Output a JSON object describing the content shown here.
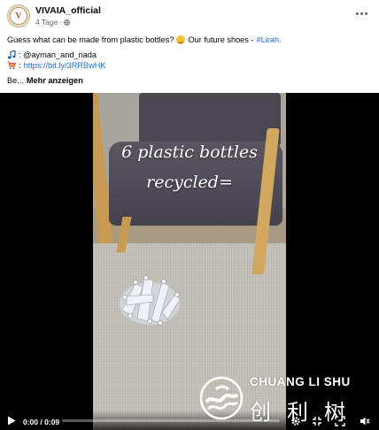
{
  "post": {
    "page_name": "VIVAIA_official",
    "timestamp": "4 Tage",
    "separator": "·",
    "avatar_text": "V",
    "privacy_icon": "globe-icon",
    "more_icon": "more-horizontal-icon",
    "text_main": "Guess what can be made from plastic bottles?",
    "text_after_emoji": "Our future shoes -",
    "hashtag": "#Leah.",
    "emoji_1": "grinning-face-emoji",
    "credit_icon": "music-note-icon",
    "credit_text": ": @ayman_and_nada",
    "link_icon": "shopping-cart-icon",
    "link_prefix": ":",
    "link_text": "https://bit.ly/3RRBwHK",
    "truncated_text": "Be...",
    "see_more_label": "Mehr anzeigen"
  },
  "video": {
    "overlay_line1": "6 plastic bottles",
    "overlay_line2": "recycled=",
    "current_time": "0:00",
    "duration": "0:09",
    "time_separator": "/",
    "progress": 0.0,
    "controls": [
      "play-icon",
      "settings-icon",
      "fullscreen-icon",
      "volume-icon"
    ]
  },
  "watermark": {
    "latin": "CHUANG LI SHU",
    "cjk": "创利树"
  },
  "colors": {
    "link": "#216fdb",
    "meta_text": "#65676b",
    "video_bg": "#000000"
  }
}
